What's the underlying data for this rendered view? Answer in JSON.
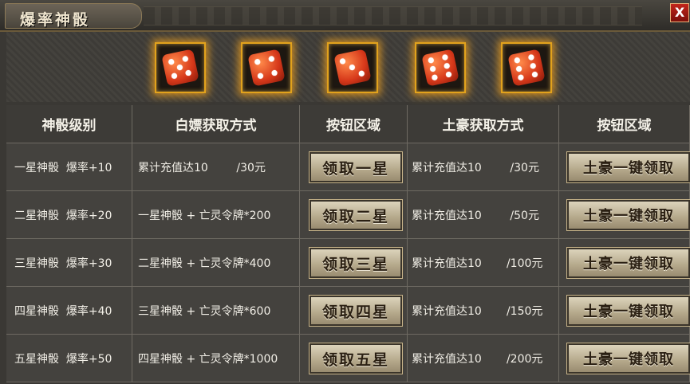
{
  "window": {
    "title": "爆率神骰",
    "close_label": "X"
  },
  "dice": [
    {
      "pips": 5
    },
    {
      "pips": 4
    },
    {
      "pips": 3
    },
    {
      "pips": 6
    },
    {
      "pips": 6
    }
  ],
  "table": {
    "headers": [
      "神骰级别",
      "白嫖获取方式",
      "按钮区域",
      "土豪获取方式",
      "按钮区域"
    ],
    "rows": [
      {
        "level": "一星神骰  爆率+10",
        "free": "累计充值达10        /30元",
        "free_btn": "领取一星",
        "paid": "累计充值达10        /30元",
        "paid_btn": "土豪一键领取"
      },
      {
        "level": "二星神骰  爆率+20",
        "free": "一星神骰 + 亡灵令牌*200",
        "free_btn": "领取二星",
        "paid": "累计充值达10        /50元",
        "paid_btn": "土豪一键领取"
      },
      {
        "level": "三星神骰  爆率+30",
        "free": "二星神骰 + 亡灵令牌*400",
        "free_btn": "领取三星",
        "paid": "累计充值达10       /100元",
        "paid_btn": "土豪一键领取"
      },
      {
        "level": "四星神骰  爆率+40",
        "free": "三星神骰 + 亡灵令牌*600",
        "free_btn": "领取四星",
        "paid": "累计充值达10       /150元",
        "paid_btn": "土豪一键领取"
      },
      {
        "level": "五星神骰  爆率+50",
        "free": "四星神骰 + 亡灵令牌*1000",
        "free_btn": "领取五星",
        "paid": "累计充值达10       /200元",
        "paid_btn": "土豪一键领取"
      }
    ]
  }
}
